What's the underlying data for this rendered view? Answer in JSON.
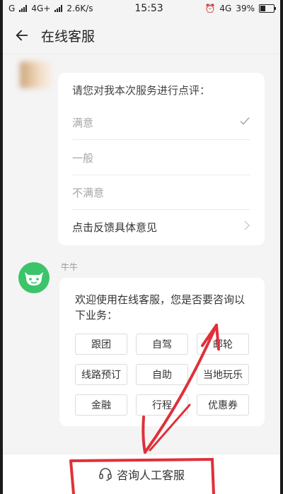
{
  "status": {
    "network_left": "G",
    "network_mid": "4G+",
    "speed": "2.6K/s",
    "time": "15:53",
    "network_right": "4G",
    "battery_label": "39%",
    "battery_level": 0.39
  },
  "header": {
    "title": "在线客服"
  },
  "evaluation": {
    "prompt": "请您对我本次服务进行点评：",
    "options": [
      "满意",
      "一般",
      "不满意"
    ],
    "selected_index": 0,
    "feedback_label": "点击反馈具体意见"
  },
  "bot": {
    "name": "牛牛",
    "welcome": "欢迎使用在线客服，您是否要咨询以下业务：",
    "services": [
      "跟团",
      "自驾",
      "邮轮",
      "线路预订",
      "自助",
      "当地玩乐",
      "金融",
      "行程",
      "优惠券"
    ]
  },
  "bottom": {
    "human_service_label": "咨询人工客服"
  },
  "colors": {
    "accent_green": "#3cc46b",
    "annotation_red": "#e0303a"
  }
}
